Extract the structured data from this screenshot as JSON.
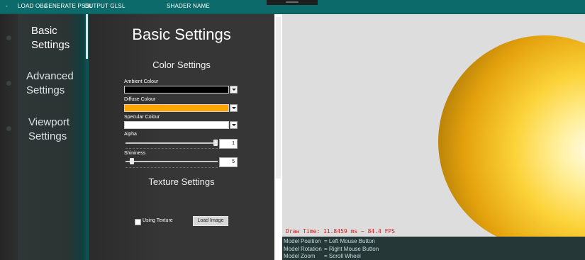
{
  "menubar": {
    "dash": "-",
    "items": [
      "LOAD OBJ",
      "GENERATE PSSL",
      "OUTPUT GLSL",
      "SHADER NAME"
    ]
  },
  "nav": {
    "items": [
      {
        "label": "Basic\nSettings",
        "active": true
      },
      {
        "label": "Advanced\nSettings",
        "active": false
      },
      {
        "label": "Viewport\nSettings",
        "active": false
      }
    ]
  },
  "panel": {
    "title": "Basic Settings",
    "color_section": "Color Settings",
    "ambient": {
      "label": "Ambient Colour",
      "color": "#000000"
    },
    "diffuse": {
      "label": "Diffuse Colour",
      "color": "#ffa500"
    },
    "specular": {
      "label": "Specular Colour",
      "color": "#ffffff"
    },
    "alpha": {
      "label": "Alpha",
      "value": "1",
      "fraction": 1.0
    },
    "shininess": {
      "label": "Shininess",
      "value": "5",
      "fraction": 0.05
    },
    "texture_section": "Texture Settings",
    "using_texture_label": "Using Texture",
    "using_texture_checked": false,
    "load_image_label": "Load Image"
  },
  "viewport": {
    "background": "#dddddd",
    "object_color": "#fcd33a",
    "fps_text": "Draw Time: 11.8459 ms ~ 84.4 FPS"
  },
  "help": [
    {
      "key": "Model Position",
      "value": "= Left Mouse Button"
    },
    {
      "key": "Model Rotation",
      "value": "= Right Mouse Button"
    },
    {
      "key": "Model Zoom",
      "value": "= Scroll Wheel"
    }
  ]
}
